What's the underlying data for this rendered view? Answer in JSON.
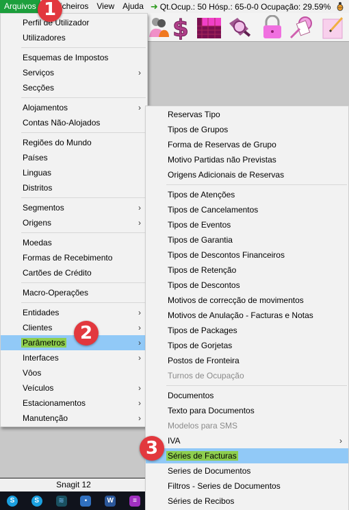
{
  "menubar": {
    "items": [
      "Arquivos",
      "Ficheiros",
      "View",
      "Ajuda"
    ],
    "status": "Qt.Ocup.: 50 Hósp.: 65-0-0 Ocupação: 29.59%"
  },
  "toolbar": {
    "icons": [
      "users-icon",
      "dollar-icon",
      "spreadsheet-icon",
      "search-folder-icon",
      "lock-icon",
      "key-document-icon",
      "notepad-pencil-icon"
    ]
  },
  "main_menu": {
    "groups": [
      [
        {
          "label": "Perfil de Utilizador"
        },
        {
          "label": "Utilizadores"
        }
      ],
      [
        {
          "label": "Esquemas de Impostos"
        },
        {
          "label": "Serviços",
          "submenu": true
        },
        {
          "label": "Secções"
        }
      ],
      [
        {
          "label": "Alojamentos",
          "submenu": true
        },
        {
          "label": "Contas Não-Alojados"
        }
      ],
      [
        {
          "label": "Regiões do Mundo"
        },
        {
          "label": "Países"
        },
        {
          "label": "Linguas"
        },
        {
          "label": "Distritos"
        }
      ],
      [
        {
          "label": "Segmentos",
          "submenu": true
        },
        {
          "label": "Origens",
          "submenu": true
        }
      ],
      [
        {
          "label": "Moedas"
        },
        {
          "label": "Formas de Recebimento"
        },
        {
          "label": "Cartões de Crédito"
        }
      ],
      [
        {
          "label": "Macro-Operações"
        }
      ],
      [
        {
          "label": "Entidades",
          "submenu": true
        },
        {
          "label": "Clientes",
          "submenu": true
        },
        {
          "label": "Parâmetros",
          "submenu": true,
          "highlighted": true
        },
        {
          "label": "Interfaces",
          "submenu": true
        },
        {
          "label": "Vôos"
        },
        {
          "label": "Veículos",
          "submenu": true
        },
        {
          "label": "Estacionamentos",
          "submenu": true
        },
        {
          "label": "Manutenção",
          "submenu": true
        }
      ]
    ]
  },
  "sub_menu": {
    "groups": [
      [
        {
          "label": "Reservas Tipo"
        },
        {
          "label": "Tipos de Grupos"
        },
        {
          "label": "Forma de Reservas de Grupo"
        },
        {
          "label": "Motivo Partidas não Previstas"
        },
        {
          "label": "Origens Adicionais de Reservas"
        }
      ],
      [
        {
          "label": "Tipos de Atenções"
        },
        {
          "label": "Tipos de Cancelamentos"
        },
        {
          "label": "Tipos de Eventos"
        },
        {
          "label": "Tipos de Garantia"
        },
        {
          "label": "Tipos de Descontos Financeiros"
        },
        {
          "label": "Tipos de Retenção"
        },
        {
          "label": "Tipos de Descontos"
        },
        {
          "label": "Motivos de correcção de movimentos"
        },
        {
          "label": "Motivos de Anulação - Facturas e Notas"
        },
        {
          "label": "Tipos de Packages"
        },
        {
          "label": "Tipos de Gorjetas"
        },
        {
          "label": "Postos de Fronteira"
        },
        {
          "label": "Turnos de Ocupação",
          "disabled": true
        }
      ],
      [
        {
          "label": "Documentos"
        },
        {
          "label": "Texto para Documentos"
        },
        {
          "label": "Modelos para SMS",
          "disabled": true
        },
        {
          "label": "IVA",
          "submenu": true
        },
        {
          "label": "Séries de Facturas",
          "highlighted": true
        },
        {
          "label": "Series de Documentos"
        },
        {
          "label": "Filtros - Series de Documentos"
        },
        {
          "label": "Séries de Recibos"
        }
      ]
    ]
  },
  "callouts": [
    "1",
    "2",
    "3"
  ],
  "snagit": {
    "title": "Snagit 12"
  },
  "taskbar": {
    "apps": [
      "skype-icon",
      "skype-icon",
      "wifi-icon",
      "remote-desktop-icon",
      "word-icon",
      "app-icon"
    ]
  },
  "colors": {
    "menu_highlight": "#91c9f7",
    "label_highlight": "#8ece4e",
    "active_menu": "#1c9f3c",
    "callout": "#e2383e"
  }
}
